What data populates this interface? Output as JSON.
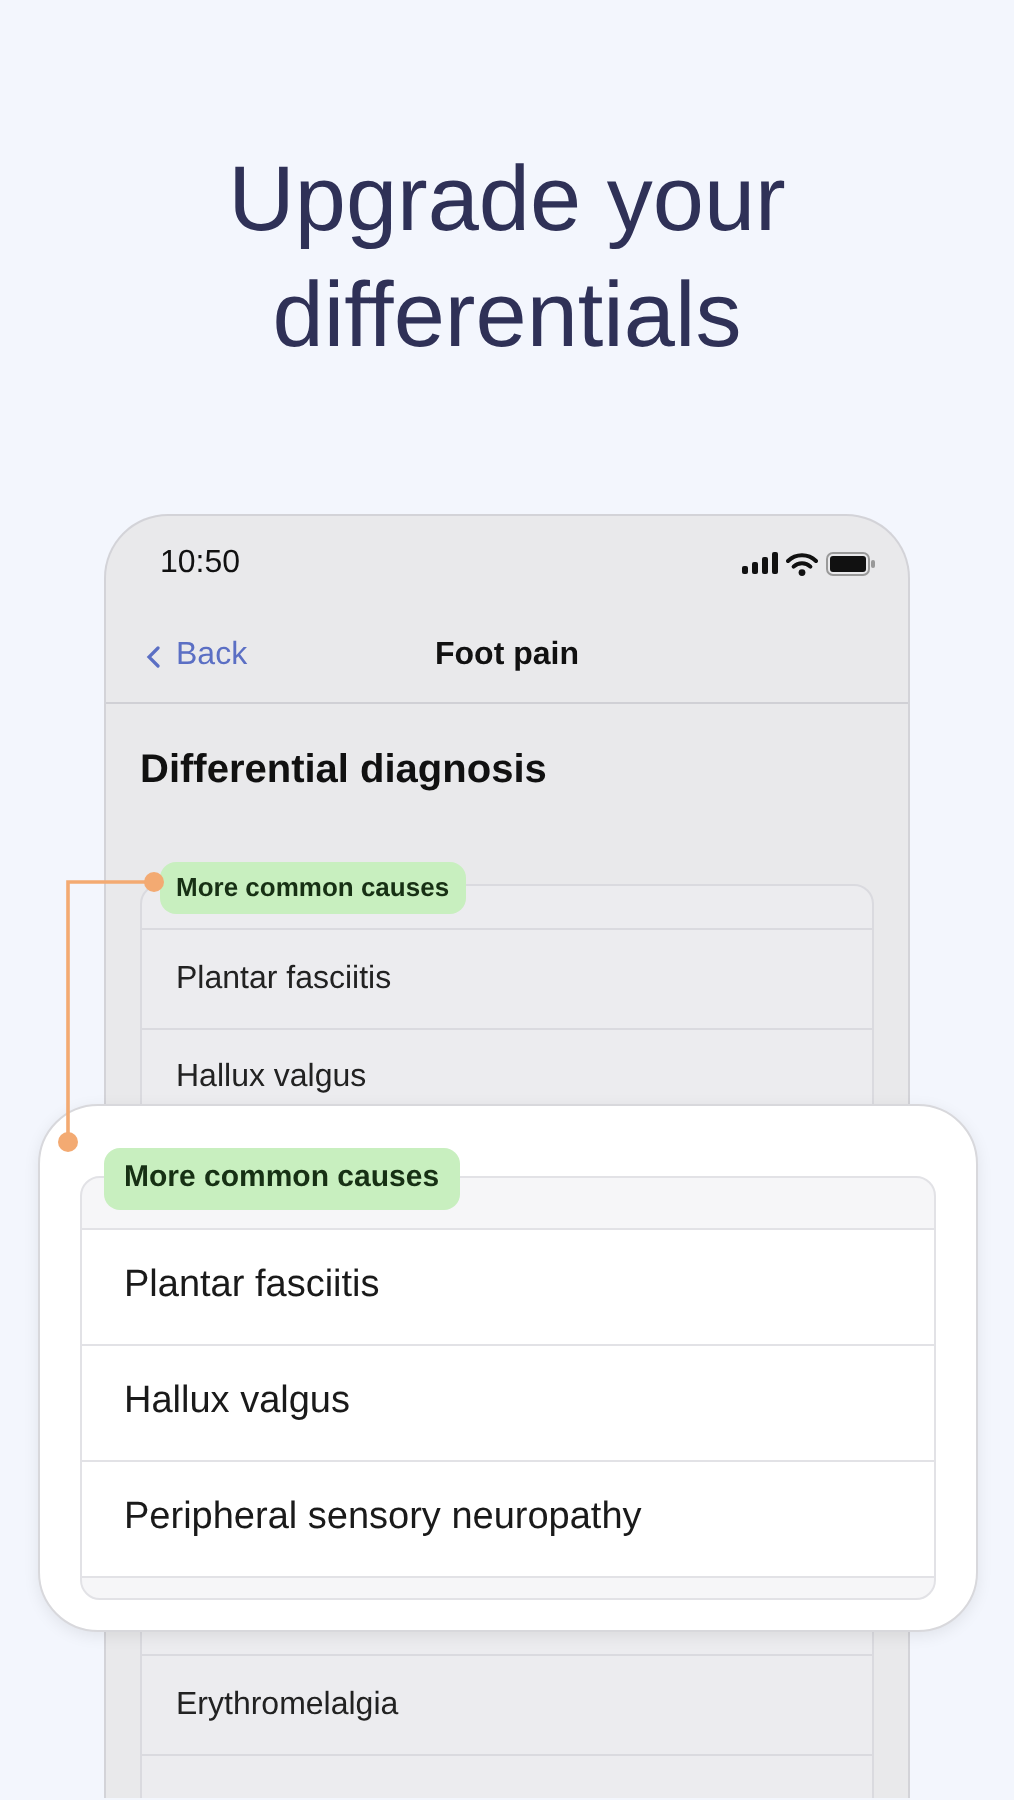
{
  "headline": "Upgrade your differentials",
  "phone": {
    "status_bar": {
      "time": "10:50"
    },
    "nav": {
      "back": "Back",
      "title": "Foot pain"
    },
    "heading": "Differential diagnosis",
    "group": {
      "label": "More common causes",
      "items": [
        "Plantar fasciitis",
        "Hallux valgus"
      ]
    },
    "more_items": [
      "Erythromelalgia"
    ]
  },
  "callout": {
    "label": "More common causes",
    "items": [
      "Plantar fasciitis",
      "Hallux valgus",
      "Peripheral sensory neuropathy"
    ]
  }
}
